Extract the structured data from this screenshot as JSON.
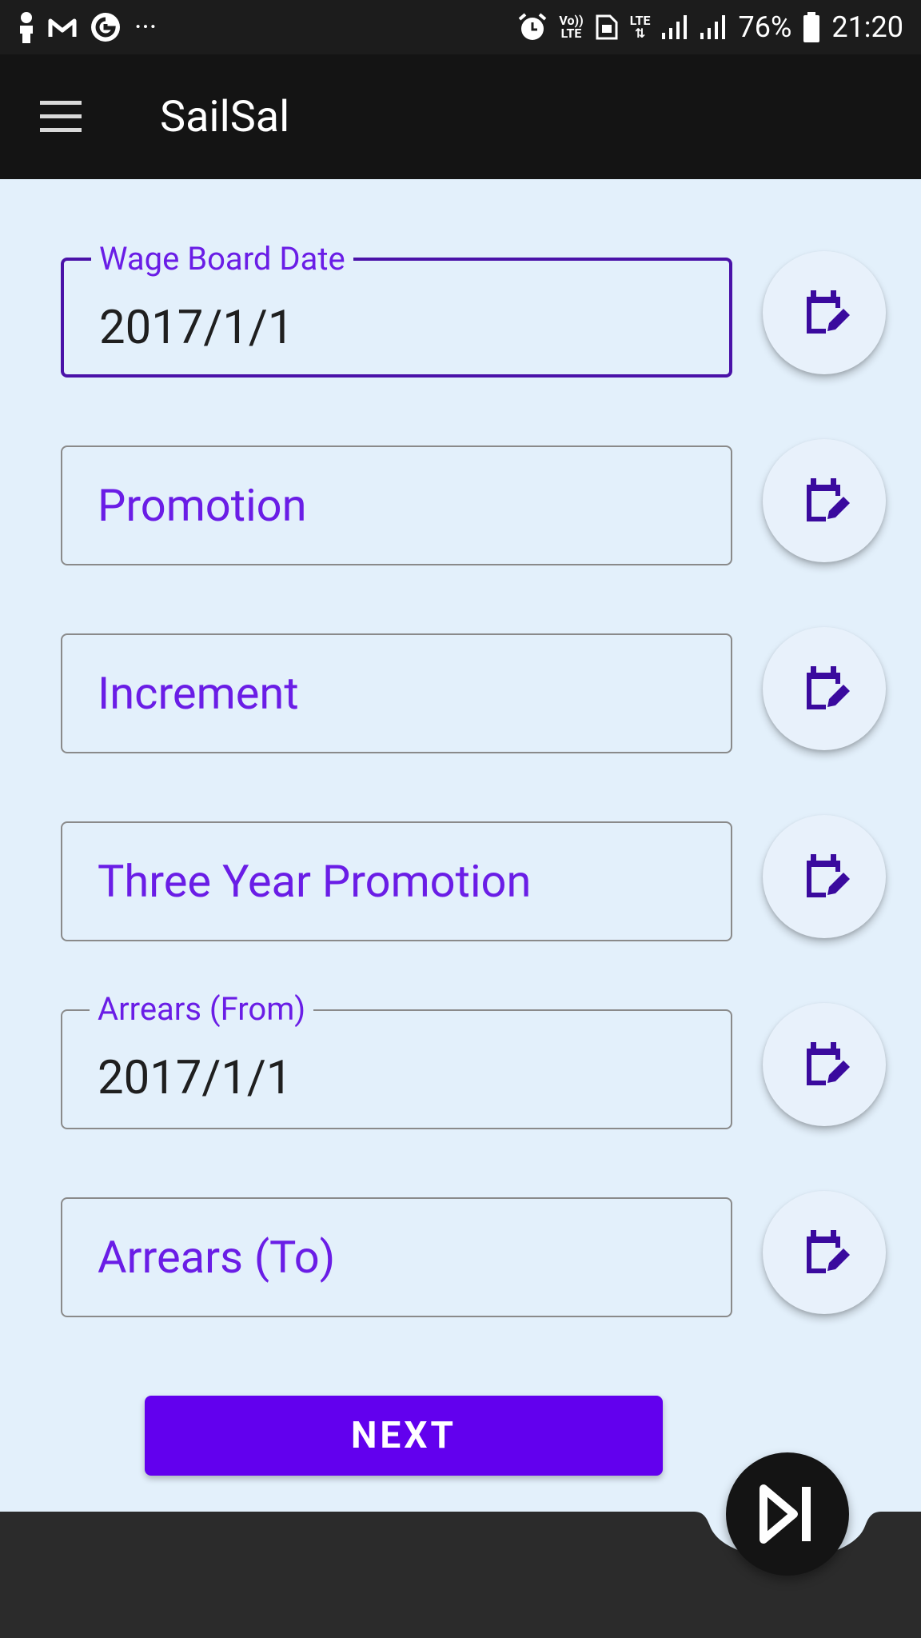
{
  "status_bar": {
    "icons": [
      "person-silhouette-icon",
      "gmail-icon",
      "google-icon",
      "more-dots-icon",
      "alarm-icon",
      "volte-icon",
      "sim-icon",
      "lte-icon",
      "signal-icon",
      "signal-icon",
      "battery-icon"
    ],
    "more_text": "···",
    "volte_top": "Vo))",
    "volte_bottom": "LTE",
    "lte_label": "LTE",
    "battery": "76%",
    "time": "21:20"
  },
  "app_bar": {
    "menu_icon": "hamburger-menu-icon",
    "title": "SailSal"
  },
  "form": {
    "fields": [
      {
        "label": "Wage Board Date",
        "value": "2017/1/1",
        "focused": true
      },
      {
        "placeholder": "Promotion"
      },
      {
        "placeholder": "Increment"
      },
      {
        "placeholder": "Three Year Promotion"
      },
      {
        "label": "Arrears (From)",
        "value": "2017/1/1"
      },
      {
        "placeholder": "Arrears (To)"
      }
    ],
    "picker_icon": "calendar-edit-icon"
  },
  "next_button": {
    "label": "NEXT"
  },
  "fab": {
    "icon": "skip-next-icon"
  },
  "colors": {
    "background": "#e3f0fb",
    "primary": "#6200ee",
    "label": "#6a1de6",
    "focused_outline": "#4a12a8",
    "icon": "#3a0a9e",
    "bar": "#141414",
    "bottom_bar": "#2b2b2b"
  }
}
